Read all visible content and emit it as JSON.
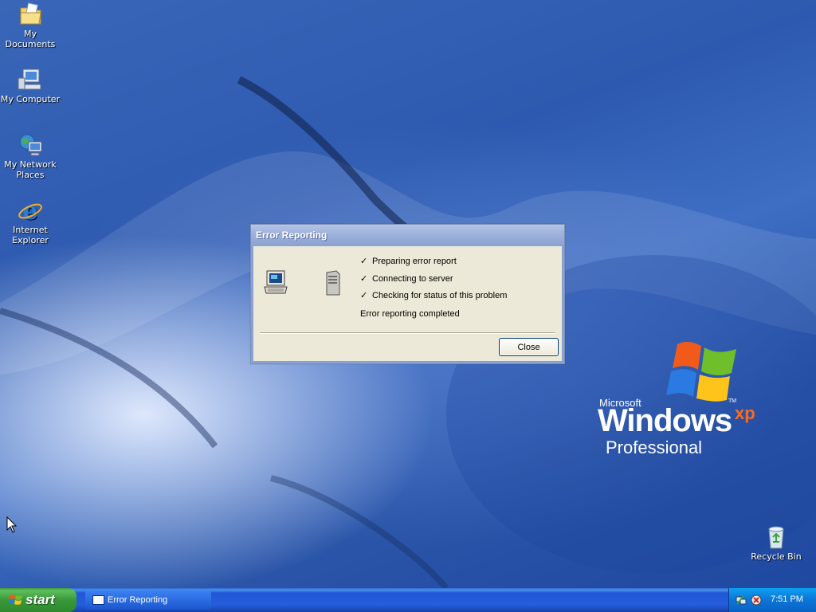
{
  "desktop": {
    "icons": [
      {
        "label": "My Documents",
        "icon": "folder-documents-icon"
      },
      {
        "label": "My Computer",
        "icon": "computer-icon"
      },
      {
        "label": "My Network Places",
        "icon": "network-places-icon"
      },
      {
        "label": "Internet Explorer",
        "icon": "internet-explorer-icon"
      },
      {
        "label": "Recycle Bin",
        "icon": "recycle-bin-icon"
      }
    ],
    "logo": {
      "microsoft": "Microsoft",
      "windows": "Windows",
      "xp": "xp",
      "edition": "Professional",
      "tm": "TM"
    }
  },
  "dialog": {
    "title": "Error Reporting",
    "steps": [
      {
        "check": "✓",
        "label": "Preparing error report"
      },
      {
        "check": "✓",
        "label": "Connecting to server"
      },
      {
        "check": "✓",
        "label": "Checking for status of this problem"
      }
    ],
    "status": "Error reporting completed",
    "close_label": "Close"
  },
  "taskbar": {
    "start_label": "start",
    "items": [
      {
        "label": "Error Reporting"
      }
    ],
    "clock": "7:51 PM"
  },
  "colors": {
    "taskbar_blue": "#245edb",
    "start_green": "#389838",
    "tray_blue": "#0b76d8",
    "dialog_bg": "#ece9d8",
    "xp_orange": "#ff6a1a"
  }
}
